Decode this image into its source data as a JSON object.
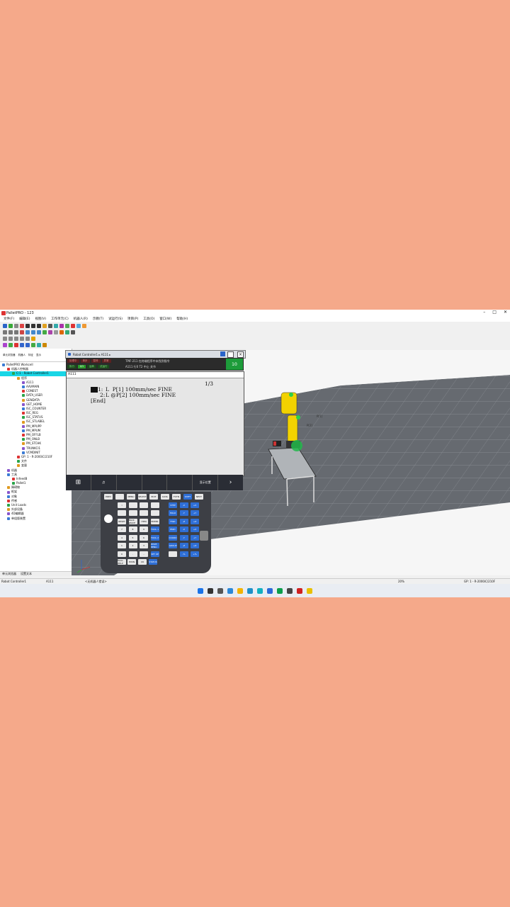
{
  "app": {
    "title": "PalletPRO - 123",
    "window_controls": [
      "–",
      "□",
      "✕"
    ]
  },
  "menu": [
    "文件(F)",
    "编辑(E)",
    "视图(V)",
    "工作单元(C)",
    "机器人(R)",
    "示教(T)",
    "试运行(S)",
    "项目(P)",
    "工具(O)",
    "窗口(W)",
    "帮助(H)"
  ],
  "tree": {
    "tools": [
      "单元浏览器",
      "机器人",
      "特征",
      "显示"
    ],
    "items": [
      {
        "label": "PalletPRO Workcell",
        "indent": 0
      },
      {
        "label": "机器人控制器",
        "indent": 1
      },
      {
        "label": "C:1 - Robot Controller1",
        "indent": 2,
        "selected": true
      },
      {
        "label": "程序",
        "indent": 3
      },
      {
        "label": "A111",
        "indent": 4
      },
      {
        "label": "AAVMAIN",
        "indent": 4
      },
      {
        "label": "CONEST",
        "indent": 4
      },
      {
        "label": "DATA_USER",
        "indent": 4
      },
      {
        "label": "GENDATA",
        "indent": 4
      },
      {
        "label": "GET_HOME",
        "indent": 4
      },
      {
        "label": "ISC_COUNTER",
        "indent": 4
      },
      {
        "label": "ISC_REG",
        "indent": 4
      },
      {
        "label": "ISC_STATUS",
        "indent": 4
      },
      {
        "label": "ISC_STLABEL",
        "indent": 4
      },
      {
        "label": "PM_MPUPP",
        "indent": 4
      },
      {
        "label": "PM_MPUM",
        "indent": 4
      },
      {
        "label": "PM_OFFLB",
        "indent": 4
      },
      {
        "label": "PM_ONLB",
        "indent": 4
      },
      {
        "label": "PM_STCHK",
        "indent": 4
      },
      {
        "label": "TRUNKCI1",
        "indent": 4
      },
      {
        "label": "VCMDINIT",
        "indent": 4
      },
      {
        "label": "GP: 1 - R-2000iC/210F",
        "indent": 3
      },
      {
        "label": "文件",
        "indent": 3
      },
      {
        "label": "变量",
        "indent": 3
      },
      {
        "label": "机器",
        "indent": 1
      },
      {
        "label": "工具",
        "indent": 1
      },
      {
        "label": "InfeedB",
        "indent": 2
      },
      {
        "label": "Pallet1",
        "indent": 2
      },
      {
        "label": "障碍物",
        "indent": 1
      },
      {
        "label": "框架",
        "indent": 1
      },
      {
        "label": "对象",
        "indent": 1
      },
      {
        "label": "传感",
        "indent": 1
      },
      {
        "label": "Unit Loads",
        "indent": 1
      },
      {
        "label": "外部设备",
        "indent": 1
      },
      {
        "label": "4D编辑器",
        "indent": 1
      },
      {
        "label": "单组版装置",
        "indent": 1
      }
    ],
    "tabs": [
      "单元浏览器",
      "设置文本"
    ]
  },
  "pendant": {
    "title": "Robot Controller1 ▸ A111 ▸",
    "status_left_row1": [
      "处理中",
      "单步",
      "暂停",
      "异常"
    ],
    "status_left_row2": [
      "执行",
      "I/O",
      "运转",
      "试运行"
    ],
    "message": "TPIF-211  在终端程序中未找到指令",
    "sub_info": "A111 行0 T2 中止 关节",
    "override": "10",
    "header_label": "A111",
    "page_indicator": "1/3",
    "program_lines": [
      {
        "num": "1:",
        "text": "L  P[1] 100mm/sec FINE"
      },
      {
        "num": "2:",
        "text": "L @P[2] 100mm/sec FINE"
      },
      {
        "num": "",
        "text": "[End]"
      }
    ],
    "softkeys": [
      "⊞",
      "点",
      "",
      "",
      "",
      "显示位置",
      "›"
    ],
    "keys": {
      "row1": [
        "PREV",
        "",
        "MENU",
        "SELECT",
        "EDIT",
        "DATA",
        "FCTN",
        "SHIFT",
        "NEXT"
      ],
      "row2": [
        "i",
        "",
        "",
        "",
        "STEP",
        "-X",
        "+X"
      ],
      "row3": [
        "",
        "",
        "",
        "",
        "HOLD",
        "-Y",
        "+Y"
      ],
      "row4": [
        "RESET",
        "BACK SPACE",
        "ITEM",
        "ENTER",
        "FWD",
        "-Z",
        "+Z"
      ],
      "row5": [
        "7",
        "8",
        "9",
        "TOOL 1",
        "BWD",
        "-X",
        "+X"
      ],
      "row6": [
        "4",
        "5",
        "6",
        "TOOL 2",
        "COORD",
        "-Y",
        "+Y"
      ],
      "row7": [
        "1",
        "2",
        "3",
        "MOVE MENU",
        "GROUP",
        "-Z",
        "+Z"
      ],
      "row8": [
        "0",
        ".",
        "-",
        "SET UP",
        "",
        "-%",
        "+%"
      ],
      "row9": [
        "POSN",
        "I/O",
        "STATUS"
      ],
      "side_label": "DIAG HELP",
      "posn_label": "POSN"
    }
  },
  "viewport": {
    "labels": [
      "P[1]",
      "P[2]"
    ]
  },
  "statusbar": {
    "controller": "Robot Controller1",
    "program": "A111",
    "robot": "<无机器人错误>",
    "zoom": "20%",
    "group": "GP: 1 - R-2000iC/210F"
  }
}
